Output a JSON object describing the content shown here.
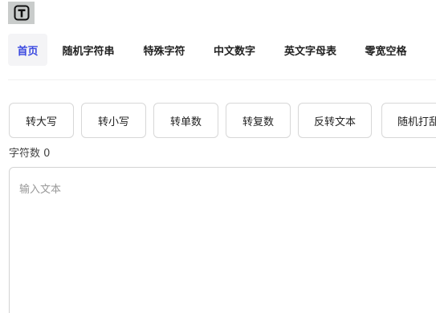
{
  "logo": {
    "icon": "text-T-icon",
    "label": "T"
  },
  "nav": {
    "items": [
      {
        "label": "首页",
        "active": true
      },
      {
        "label": "随机字符串",
        "active": false
      },
      {
        "label": "特殊字符",
        "active": false
      },
      {
        "label": "中文数字",
        "active": false
      },
      {
        "label": "英文字母表",
        "active": false
      },
      {
        "label": "零宽空格",
        "active": false
      }
    ]
  },
  "toolbar": {
    "buttons": [
      {
        "label": "转大写"
      },
      {
        "label": "转小写"
      },
      {
        "label": "转单数"
      },
      {
        "label": "转复数"
      },
      {
        "label": "反转文本"
      },
      {
        "label": "随机打乱"
      }
    ]
  },
  "counter": {
    "label": "字符数",
    "value": "0"
  },
  "editor": {
    "value": "",
    "placeholder": "输入文本"
  },
  "colors": {
    "accent": "#3a48e0",
    "active_bg": "#f4f4f6",
    "border": "#d7d7d7"
  }
}
